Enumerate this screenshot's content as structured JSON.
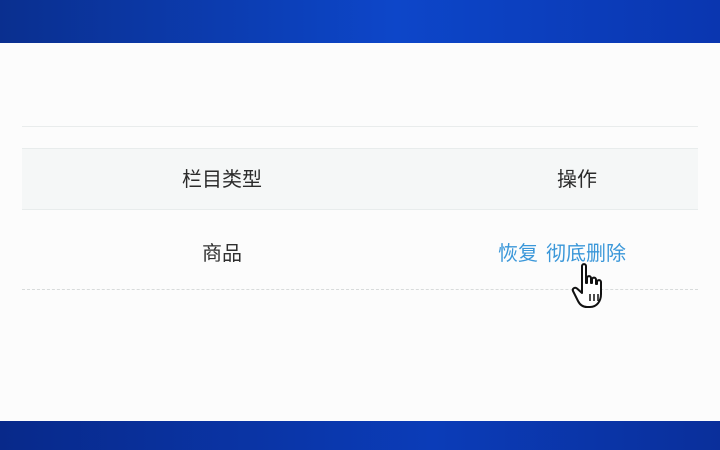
{
  "table": {
    "headers": {
      "category_type": "栏目类型",
      "operation": "操作"
    },
    "rows": [
      {
        "category_type": "商品",
        "actions": {
          "restore": "恢复",
          "delete_permanently": "彻底删除"
        }
      }
    ]
  },
  "colors": {
    "top_bar": "#0d46c9",
    "bottom_bar": "#0b3cb8",
    "link": "#3a97d9",
    "header_bg": "#f5f7f7"
  },
  "icons": {
    "cursor": "hand-pointer-icon"
  }
}
